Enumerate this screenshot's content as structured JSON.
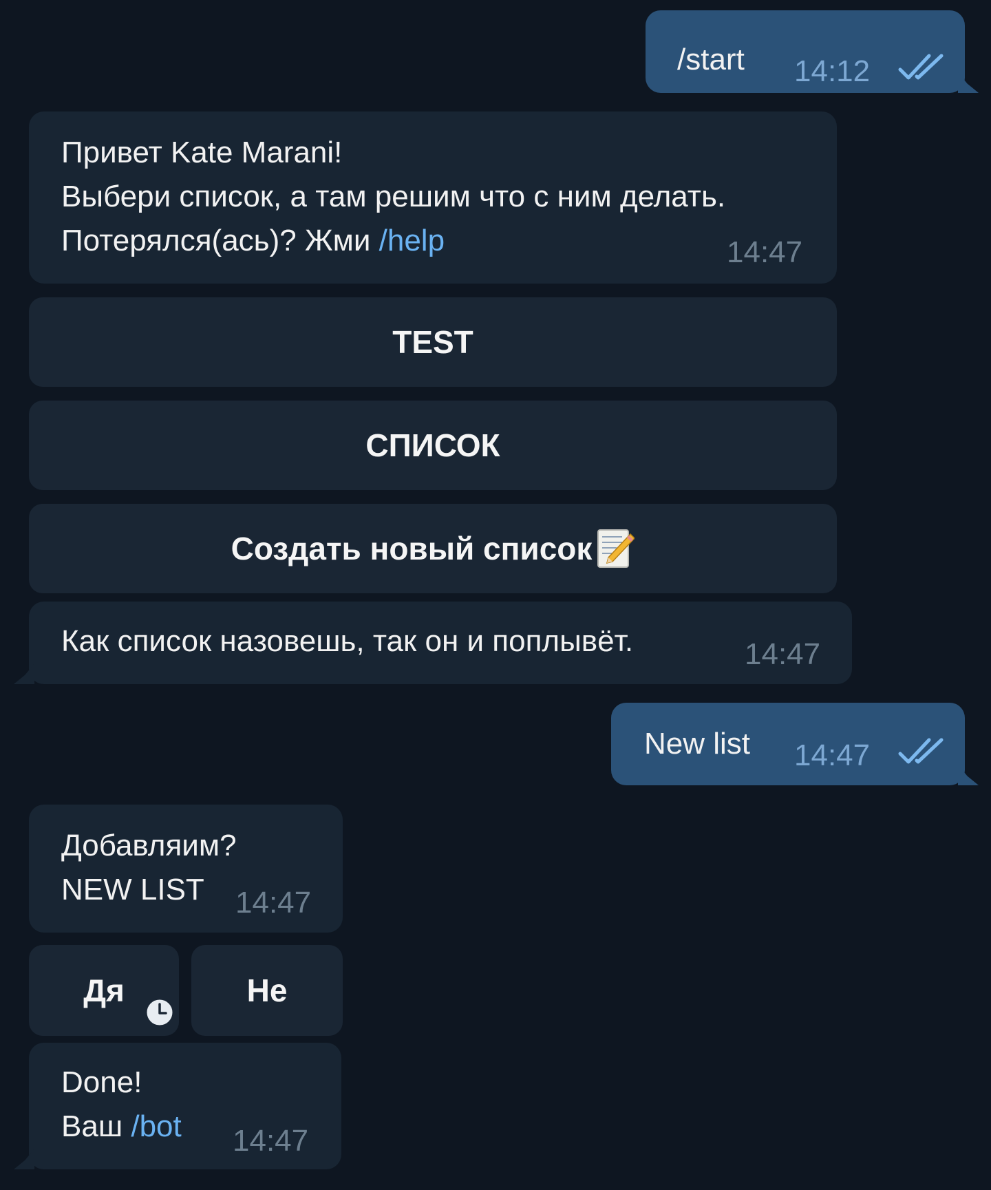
{
  "messages": {
    "m1_out": {
      "text": "/start",
      "time": "14:12"
    },
    "m2_in": {
      "line1": "Привет Kate Marani!",
      "line2": "Выбери список, а там решим что с ним делать.",
      "line3_prefix": "Потерялся(ась)? Жми ",
      "line3_link": "/help",
      "time": "14:47"
    },
    "keyboard1": {
      "btn1": "TEST",
      "btn2": "СПИСОК",
      "btn3": "Создать новый список"
    },
    "m3_in": {
      "text": "Как список назовешь, так он и поплывёт.",
      "time": "14:47"
    },
    "m4_out": {
      "text": "New list",
      "time": "14:47"
    },
    "m5_in": {
      "line1": "Добавляим?",
      "line2": "NEW LIST",
      "time": "14:47"
    },
    "keyboard2": {
      "yes": "Дя",
      "no": "Не"
    },
    "m6_in": {
      "line1": "Done!",
      "line2_prefix": "Ваш ",
      "line2_link": "/bot",
      "time": "14:47"
    }
  },
  "icons": {
    "read_receipt": "double-check-icon",
    "memo": "memo-pencil-icon",
    "pending": "clock-icon"
  },
  "colors": {
    "background": "#0e1621",
    "outgoing": "#2b5278",
    "incoming": "#182533",
    "link": "#6ab2f2"
  }
}
